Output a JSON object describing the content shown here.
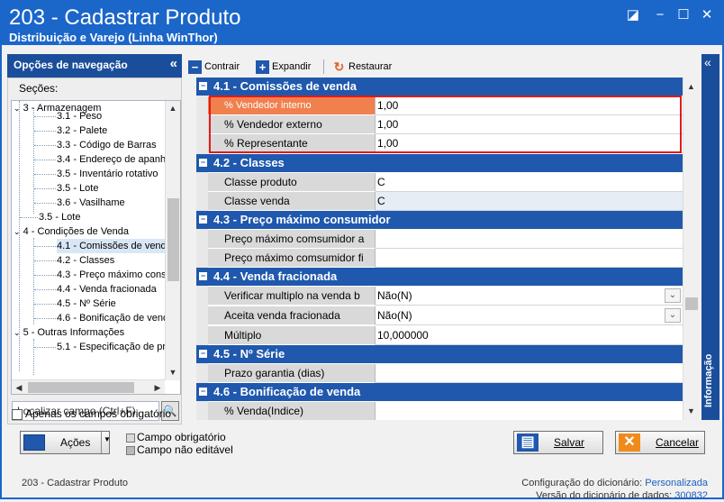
{
  "window": {
    "title": "203 - Cadastrar  Produto",
    "subtitle": "Distribuição e Varejo (Linha WinThor)"
  },
  "nav": {
    "header": "Opções de navegação",
    "sections_label": "Seções:",
    "items": [
      {
        "label": "3 - Armazenagem",
        "level": 0,
        "expanded": true
      },
      {
        "label": "3.1 - Peso",
        "level": 1
      },
      {
        "label": "3.2 - Palete",
        "level": 1
      },
      {
        "label": "3.3 - Código de Barras",
        "level": 1
      },
      {
        "label": "3.4 - Endereço de apanha",
        "level": 1
      },
      {
        "label": "3.5 - Inventário rotativo",
        "level": 1
      },
      {
        "label": "3.5 - Lote",
        "level": 1
      },
      {
        "label": "3.6 - Vasilhame",
        "level": 1
      },
      {
        "label": "3.5 - Lote",
        "level": 0
      },
      {
        "label": "4 - Condições de Venda",
        "level": 0,
        "expanded": true
      },
      {
        "label": "4.1 - Comissões de venda",
        "level": 1,
        "selected": true
      },
      {
        "label": "4.2 - Classes",
        "level": 1
      },
      {
        "label": "4.3 - Preço máximo consu",
        "level": 1
      },
      {
        "label": "4.4 - Venda fracionada",
        "level": 1
      },
      {
        "label": "4.5 - Nº Série",
        "level": 1
      },
      {
        "label": "4.6 - Bonificação de venda",
        "level": 1
      },
      {
        "label": "5 - Outras Informações",
        "level": 0,
        "expanded": true
      },
      {
        "label": "5.1 - Especificação de pro",
        "level": 1
      }
    ],
    "search_placeholder": "Localizar campo (Ctrl+F)",
    "required_only_label": "Apenas os campos obrigatório"
  },
  "toolbar": {
    "collapse_label": "Contrair",
    "expand_label": "Expandir",
    "restore_label": "Restaurar"
  },
  "grid": {
    "categories": [
      {
        "title": "4.1 - Comissões de venda",
        "rows": [
          {
            "name": "% Vendedor interno",
            "value": "1,00",
            "highlight": true
          },
          {
            "name": "% Vendedor externo",
            "value": "1,00"
          },
          {
            "name": "% Representante",
            "value": "1,00"
          }
        ]
      },
      {
        "title": "4.2 - Classes",
        "rows": [
          {
            "name": "Classe produto",
            "value": "C"
          },
          {
            "name": "Classe venda",
            "value": "C",
            "readonly": true
          }
        ]
      },
      {
        "title": "4.3 - Preço máximo consumidor",
        "rows": [
          {
            "name": "Preço máximo comsumidor a",
            "value": ""
          },
          {
            "name": "Preço máximo comsumidor fi",
            "value": ""
          }
        ]
      },
      {
        "title": "4.4 - Venda fracionada",
        "rows": [
          {
            "name": "Verificar multiplo na venda b",
            "value": "Não(N)",
            "dropdown": true
          },
          {
            "name": "Aceita venda fracionada",
            "value": "Não(N)",
            "dropdown": true
          },
          {
            "name": "Múltiplo",
            "value": "10,000000"
          }
        ]
      },
      {
        "title": "4.5 - Nº Série",
        "rows": [
          {
            "name": "Prazo garantia (dias)",
            "value": ""
          }
        ]
      },
      {
        "title": "4.6 - Bonificação de venda",
        "rows": [
          {
            "name": "% Venda(Indice)",
            "value": ""
          }
        ]
      }
    ]
  },
  "info_panel": {
    "label": "Informação"
  },
  "bottom": {
    "actions_label": "Ações",
    "legend_required": "Campo obrigatório",
    "legend_noneditable": "Campo não editável",
    "save_label": "Salvar",
    "cancel_label": "Cancelar"
  },
  "footer": {
    "left": "203 - Cadastrar  Produto",
    "dict_config_label": "Configuração do dicionário:",
    "dict_config_value": "Personalizada",
    "dict_version_label": "Versão do dicionário de dados:",
    "dict_version_value": "300832"
  },
  "colors": {
    "title_bar": "#1b66c9",
    "category_header": "#1f58ad",
    "highlight_row": "#f0804e",
    "red_outline": "#e01b1b"
  }
}
